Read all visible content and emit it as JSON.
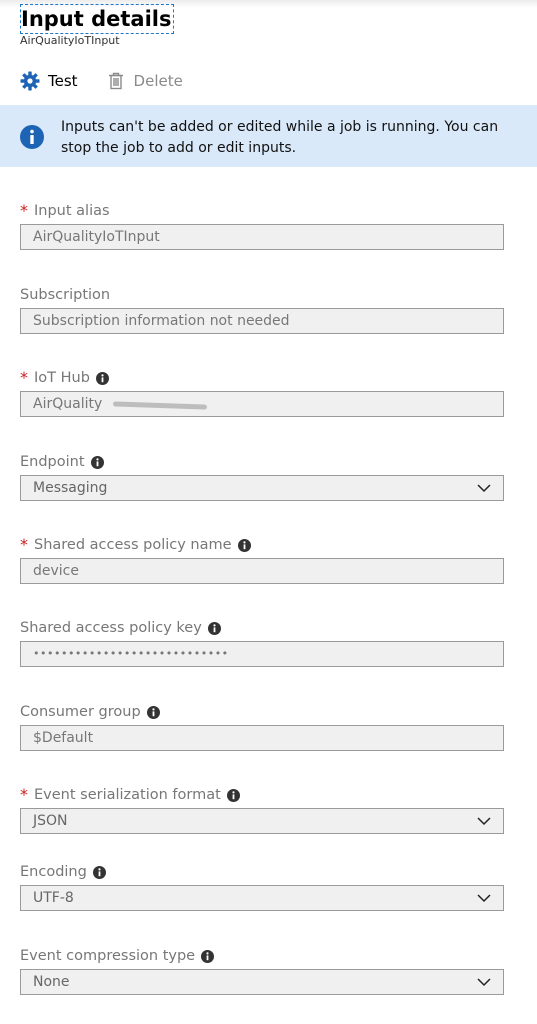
{
  "header": {
    "title": "Input details",
    "subtitle": "AirQualityIoTInput"
  },
  "toolbar": {
    "test_label": "Test",
    "delete_label": "Delete"
  },
  "banner": {
    "message": "Inputs can't be added or edited while a job is running. You can stop the job to add or edit inputs.",
    "icon": "info-icon",
    "color": "#dae9fa"
  },
  "fields": {
    "input_alias": {
      "label": "Input alias",
      "value": "AirQualityIoTInput"
    },
    "subscription": {
      "label": "Subscription",
      "value": "Subscription information not needed"
    },
    "iot_hub": {
      "label": "IoT Hub",
      "value": "AirQuality"
    },
    "endpoint": {
      "label": "Endpoint",
      "value": "Messaging"
    },
    "policy_name": {
      "label": "Shared access policy name",
      "value": "device"
    },
    "policy_key": {
      "label": "Shared access policy key",
      "value": "••••••••••••••••••••••••••••"
    },
    "consumer_group": {
      "label": "Consumer group",
      "value": "$Default"
    },
    "serialization": {
      "label": "Event serialization format",
      "value": "JSON"
    },
    "encoding": {
      "label": "Encoding",
      "value": "UTF-8"
    },
    "compression": {
      "label": "Event compression type",
      "value": "None"
    }
  },
  "colors": {
    "accent": "#1e64b4",
    "required": "#c81e1e",
    "disabled_text": "#8a8a8a"
  }
}
